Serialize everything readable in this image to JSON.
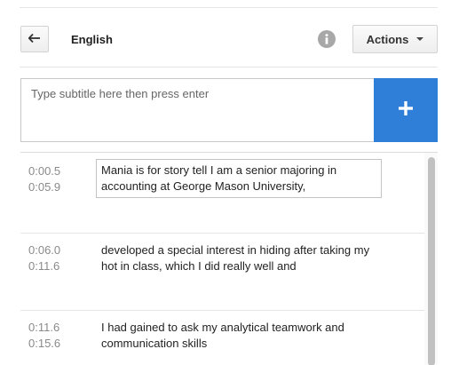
{
  "header": {
    "back_icon": "arrow-left-icon",
    "language": "English",
    "info_icon": "info-icon",
    "actions_label": "Actions"
  },
  "subtitle_input": {
    "placeholder": "Type subtitle here then press enter",
    "value": "",
    "add_icon": "plus-icon"
  },
  "colors": {
    "accent": "#2f7ed8",
    "timestamp": "#8a8a8a",
    "border": "#d3d3d3"
  },
  "subtitles": [
    {
      "start": "0:00.5",
      "end": "0:05.9",
      "text": "Mania is for story tell I am a senior majoring in accounting at George Mason University,",
      "editing": true
    },
    {
      "start": "0:06.0",
      "end": "0:11.6",
      "text": "developed a special interest in hiding after taking my hot in class, which I did really well and",
      "editing": false
    },
    {
      "start": "0:11.6",
      "end": "0:15.6",
      "text": "I had gained to ask my analytical teamwork and communication skills",
      "editing": false
    }
  ]
}
